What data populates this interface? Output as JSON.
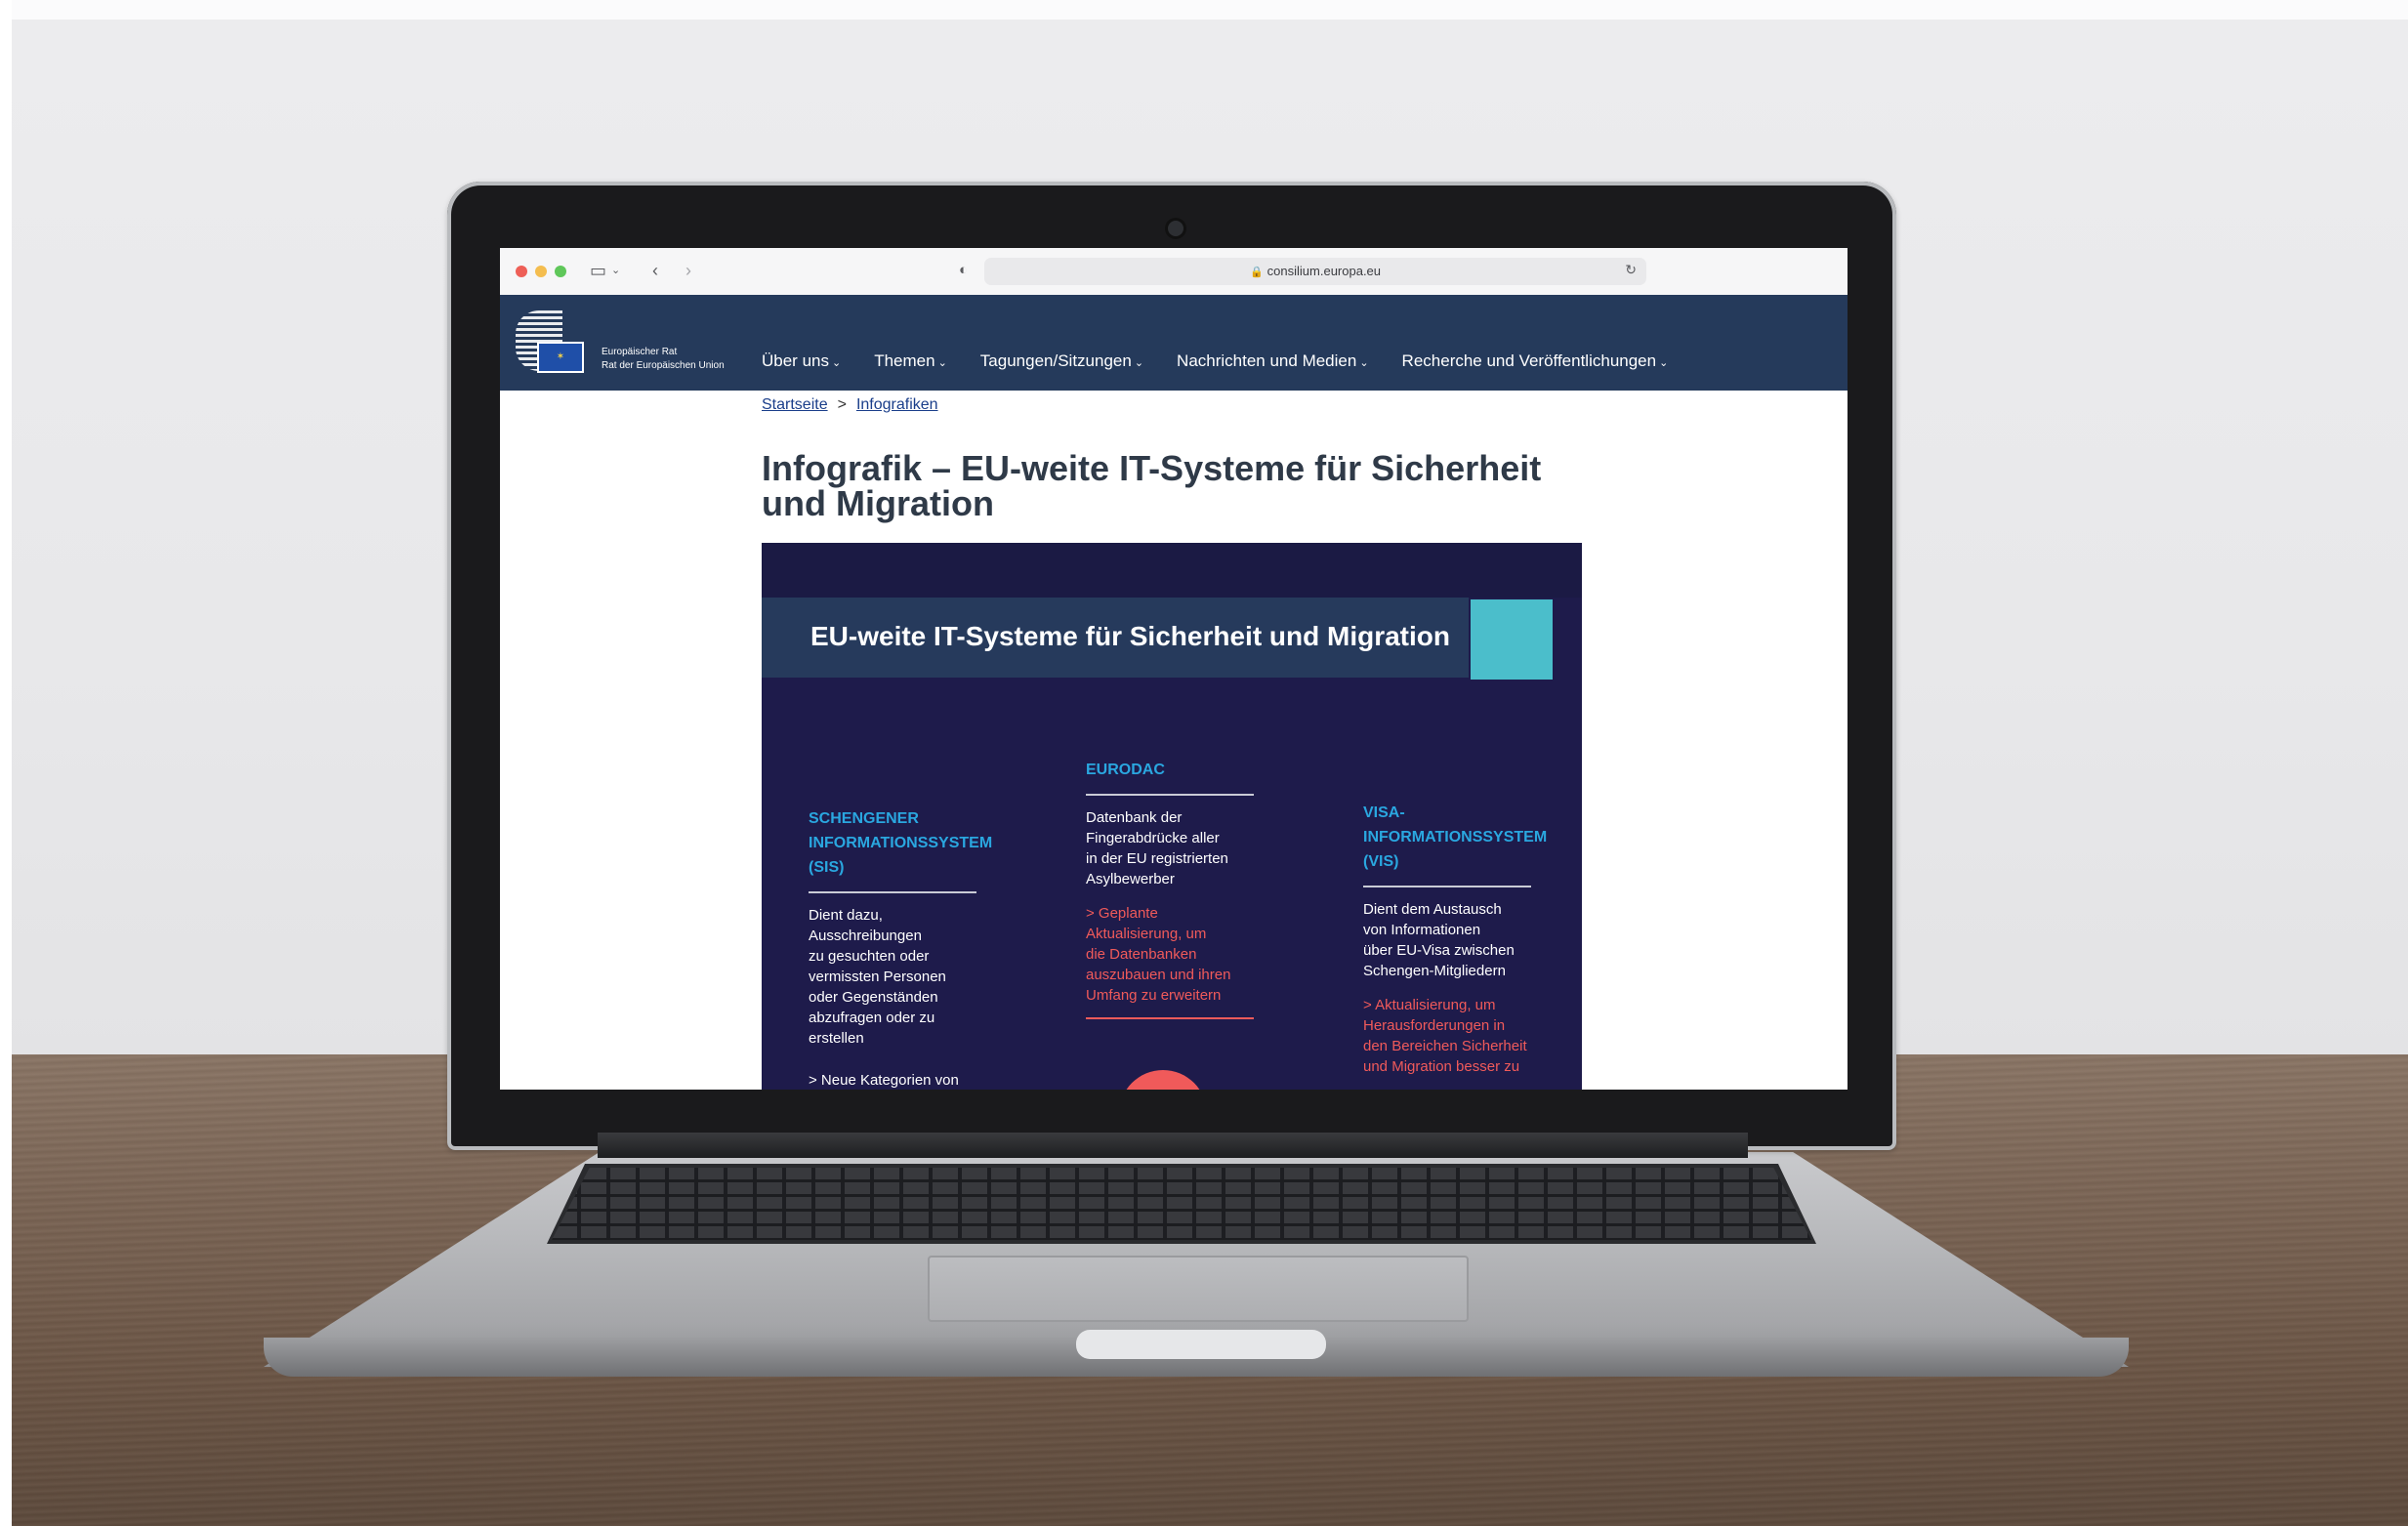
{
  "browser": {
    "url": "consilium.europa.eu"
  },
  "site": {
    "logo_line1": "Europäischer Rat",
    "logo_line2": "Rat der Europäischen Union",
    "nav": [
      {
        "label": "Über uns"
      },
      {
        "label": "Themen"
      },
      {
        "label": "Tagungen/Sitzungen"
      },
      {
        "label": "Nachrichten und Medien"
      },
      {
        "label": "Recherche und Veröffentlichungen"
      }
    ]
  },
  "breadcrumb": {
    "home": "Startseite",
    "separator": ">",
    "current": "Infografiken"
  },
  "page": {
    "title": "Infografik – EU-weite IT-Systeme für Sicherheit und Migration"
  },
  "infographic": {
    "title": "EU-weite IT-Systeme für Sicherheit und Migration",
    "columns": [
      {
        "title": "SCHENGENER\nINFORMATIONSSYSTEM\n(SIS)",
        "body": "Dient dazu,\nAusschreibungen\nzu gesuchten oder\nvermissten Personen\noder Gegenständen\nabzufragen oder zu\nerstellen",
        "note": "> Neue Kategorien von"
      },
      {
        "title": "EURODAC",
        "body": "Datenbank der\nFingerabdrücke aller\nin der EU registrierten\nAsylbewerber",
        "note": "> Geplante\nAktualisierung, um\ndie Datenbanken\nauszubauen und ihren\nUmfang zu erweitern"
      },
      {
        "title": "VISA-\nINFORMATIONSSYSTEM\n(VIS)",
        "body": "Dient dem Austausch\nvon Informationen\nüber EU-Visa zwischen\nSchengen-Mitgliedern",
        "note": "> Aktualisierung, um\nHerausforderungen in\nden Bereichen Sicherheit\nund Migration besser zu"
      }
    ],
    "colors": {
      "background": "#1e1b4b",
      "header": "#263a5c",
      "accent": "#4bbecb",
      "title_blue": "#2aa7e0",
      "note_red": "#f05a5a"
    }
  }
}
